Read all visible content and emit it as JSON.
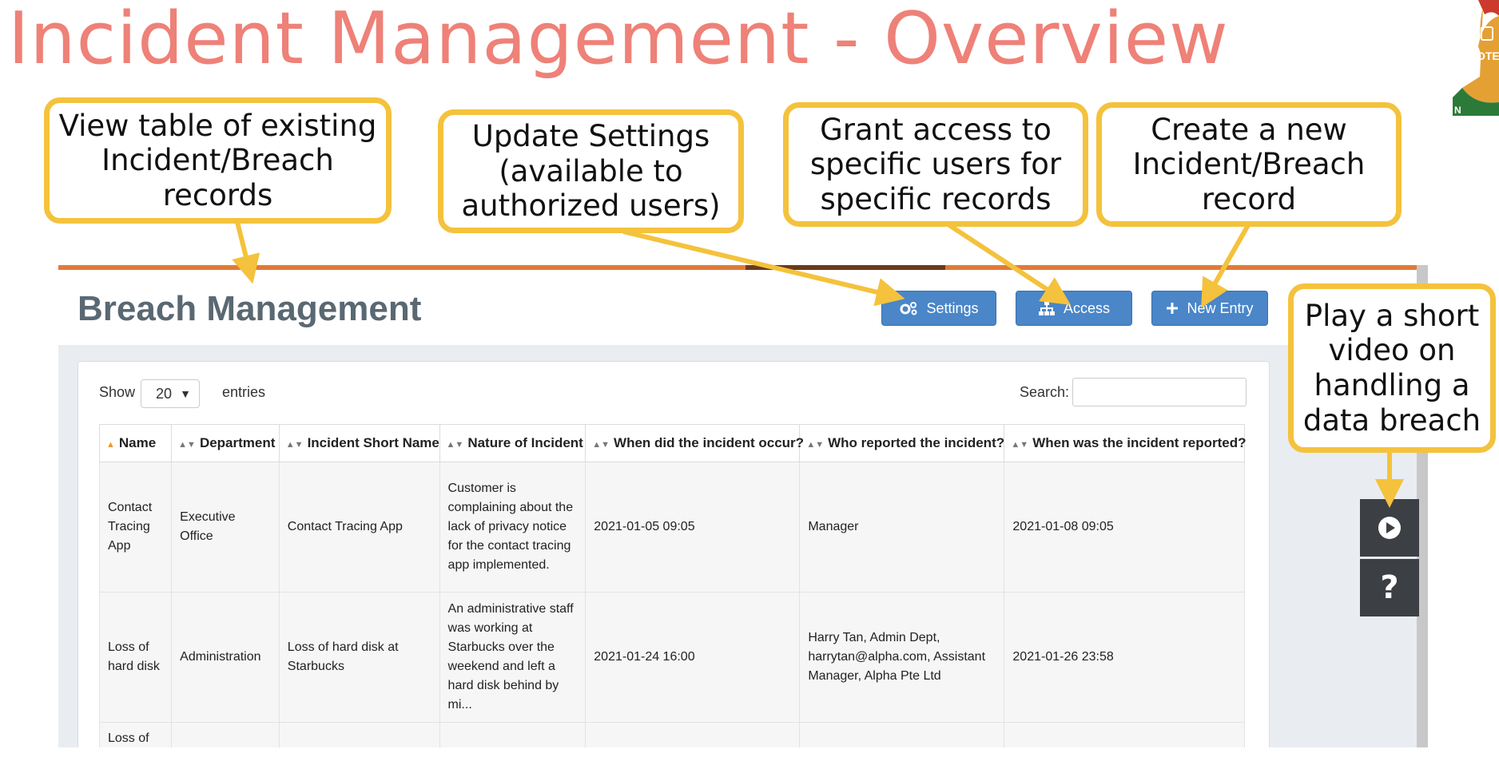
{
  "slide": {
    "title": "Incident Management - Overview",
    "logo_text": "PROTECT",
    "logo_fragment": "N"
  },
  "callouts": {
    "table": "View table of existing Incident/Breach records",
    "settings": "Update Settings (available to authorized users)",
    "access": "Grant access to specific users for specific records",
    "new_entry": "Create a new Incident/Breach record",
    "video": "Play a short video on handling a data breach"
  },
  "app": {
    "page_title": "Breach Management",
    "buttons": {
      "settings": "Settings",
      "access": "Access",
      "new_entry": "New Entry"
    },
    "show_label": "Show",
    "entries_value": "20",
    "entries_label": "entries",
    "search_label": "Search:",
    "search_value": ""
  },
  "table": {
    "headers": [
      "Name",
      "Department",
      "Incident Short Name",
      "Nature of Incident",
      "When did the incident occur?",
      "Who reported the incident?",
      "When was the incident reported?"
    ],
    "rows": [
      [
        "Contact Tracing App",
        "Executive Office",
        "Contact Tracing App",
        "Customer is complaining about the lack of privacy notice for the contact tracing app implemented.",
        "2021-01-05 09:05",
        "Manager",
        "2021-01-08 09:05"
      ],
      [
        "Loss of hard disk",
        "Administration",
        "Loss of hard disk at Starbucks",
        "An administrative staff was working at Starbucks over the weekend and left a hard disk behind by mi...",
        "2021-01-24 16:00",
        "Harry Tan, Admin Dept, harrytan@alpha.com, Assistant Manager, Alpha Pte Ltd",
        "2021-01-26 23:58"
      ],
      [
        "Loss of",
        "",
        "",
        "",
        "",
        "",
        ""
      ]
    ]
  },
  "side_buttons": {
    "play_icon": "play-icon",
    "help_icon": "question-icon"
  },
  "colors": {
    "title": "#ee8178",
    "callout_border": "#f4c23c",
    "button": "#4a86c8",
    "accent_bar": "#e07b39"
  }
}
